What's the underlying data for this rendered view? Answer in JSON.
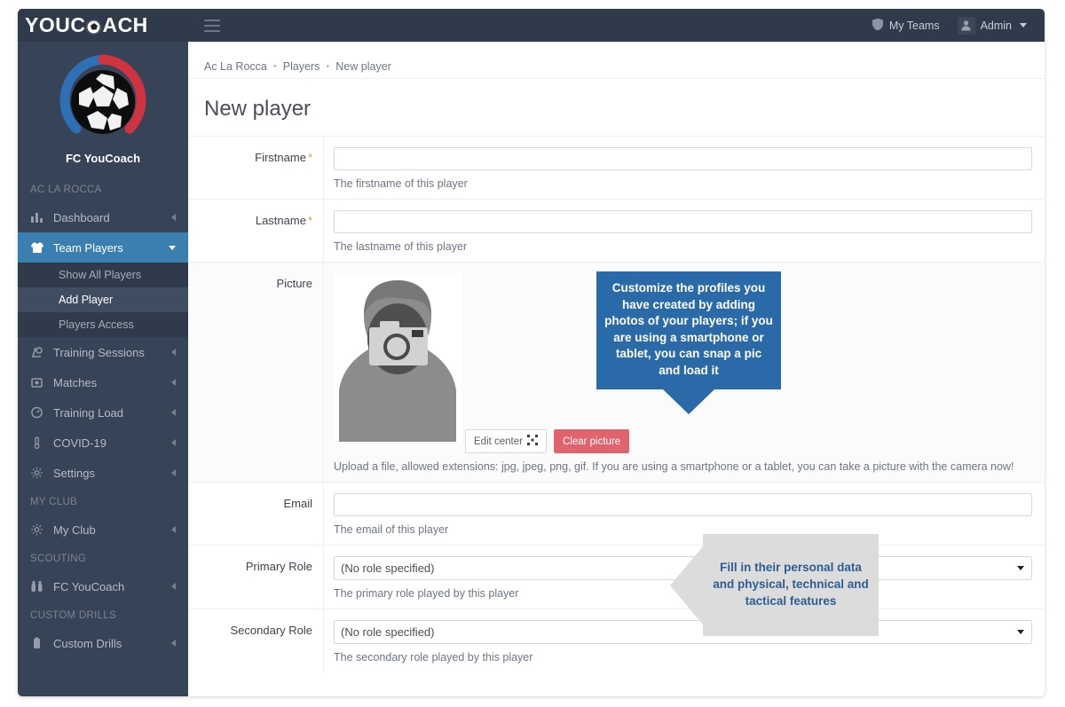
{
  "header": {
    "brand_before": "YOUC",
    "brand_after": "ACH",
    "ball_icon": "soccer-ball-icon",
    "menu_icon": "hamburger-menu-icon",
    "my_teams_label": "My Teams",
    "my_teams_icon": "shield-icon",
    "admin_label": "Admin",
    "admin_icon": "user-avatar-icon",
    "admin_caret_icon": "chevron-down-icon"
  },
  "sidebar": {
    "club_logo_icon": "soccer-ball-crest-icon",
    "club_name": "FC YouCoach",
    "sections": [
      {
        "title": "AC LA ROCCA",
        "items": [
          {
            "label": "Dashboard",
            "icon": "bar-chart-icon",
            "chevron": "chevron-left-icon",
            "active": false
          },
          {
            "label": "Team Players",
            "icon": "jersey-icon",
            "chevron": "chevron-down-icon",
            "active": true,
            "subitems": [
              {
                "label": "Show All Players",
                "active": false
              },
              {
                "label": "Add Player",
                "active": true
              },
              {
                "label": "Players Access",
                "active": false
              }
            ]
          },
          {
            "label": "Training Sessions",
            "icon": "cone-icon",
            "chevron": "chevron-left-icon",
            "active": false
          },
          {
            "label": "Matches",
            "icon": "whistle-icon",
            "chevron": "chevron-left-icon",
            "active": false
          },
          {
            "label": "Training Load",
            "icon": "gauge-icon",
            "chevron": "chevron-left-icon",
            "active": false
          },
          {
            "label": "COVID-19",
            "icon": "thermometer-icon",
            "chevron": "chevron-left-icon",
            "active": false
          },
          {
            "label": "Settings",
            "icon": "gear-icon",
            "chevron": "chevron-left-icon",
            "active": false
          }
        ]
      },
      {
        "title": "MY CLUB",
        "items": [
          {
            "label": "My Club",
            "icon": "gear-icon",
            "chevron": "chevron-left-icon",
            "active": false
          }
        ]
      },
      {
        "title": "SCOUTING",
        "items": [
          {
            "label": "FC YouCoach",
            "icon": "binoculars-icon",
            "chevron": "chevron-left-icon",
            "active": false
          }
        ]
      },
      {
        "title": "CUSTOM DRILLS",
        "items": [
          {
            "label": "Custom Drills",
            "icon": "clipboard-icon",
            "chevron": "chevron-left-icon",
            "active": false
          }
        ]
      }
    ]
  },
  "breadcrumb": {
    "items": [
      "Ac La Rocca",
      "Players",
      "New player"
    ],
    "separator": "•"
  },
  "page": {
    "title": "New player"
  },
  "form": {
    "firstname": {
      "label": "Firstname",
      "required_marker": "*",
      "value": "",
      "placeholder": "",
      "help": "The firstname of this player"
    },
    "lastname": {
      "label": "Lastname",
      "required_marker": "*",
      "value": "",
      "placeholder": "",
      "help": "The lastname of this player"
    },
    "picture": {
      "label": "Picture",
      "avatar_icon": "person-placeholder-with-camera-icon",
      "edit_center_label": "Edit center",
      "edit_center_icon": "move-crop-icon",
      "clear_picture_label": "Clear picture",
      "help": "Upload a file, allowed extensions: jpg, jpeg, png, gif. If you are using a smartphone or a tablet, you can take a picture with the camera now!"
    },
    "email": {
      "label": "Email",
      "value": "",
      "placeholder": "",
      "help": "The email of this player"
    },
    "primary_role": {
      "label": "Primary Role",
      "value": "(No role specified)",
      "caret_icon": "dropdown-caret-icon",
      "help": "The primary role played by this player"
    },
    "secondary_role": {
      "label": "Secondary Role",
      "value": "(No role specified)",
      "caret_icon": "dropdown-caret-icon",
      "help": "The secondary role played by this player"
    }
  },
  "tooltips": {
    "picture_tip": "Customize the profiles you have created by adding photos of your players; if you are using a smartphone or tablet, you can snap a pic and load it",
    "roles_tip": "Fill in their personal data and physical, technical and tactical features"
  },
  "colors": {
    "header_bg": "#2f3a4b",
    "sidebar_bg": "#374357",
    "sidebar_active": "#3b7fb0",
    "subnav_bg": "#2f3a4b",
    "tip_blue": "#2a6aa8",
    "tip_gray": "#dcdcdc",
    "tip_gray_text": "#2e5c94",
    "danger": "#e0636e",
    "required": "#d9a05b"
  }
}
